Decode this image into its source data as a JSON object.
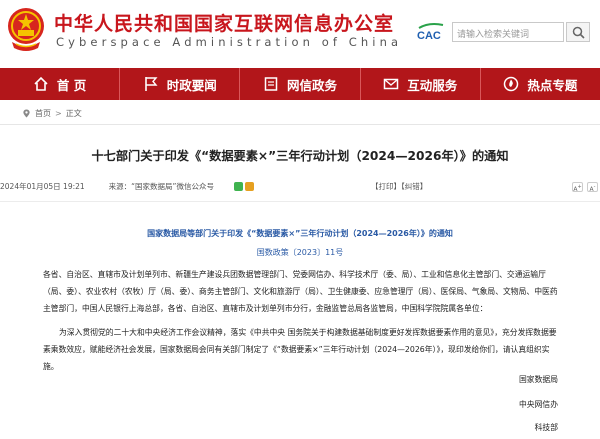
{
  "header": {
    "site_title": "中华人民共和国国家互联网信息办公室",
    "site_subtitle": "Cyberspace  Administration  of  China",
    "logo_text": "CAC",
    "search_placeholder": "请输入检索关键词"
  },
  "nav": {
    "items": [
      {
        "label": "首  页",
        "icon": "home-icon"
      },
      {
        "label": "时政要闻",
        "icon": "flag-icon"
      },
      {
        "label": "网信政务",
        "icon": "document-icon"
      },
      {
        "label": "互动服务",
        "icon": "mail-icon"
      },
      {
        "label": "热点专题",
        "icon": "hot-icon"
      }
    ]
  },
  "breadcrumb": {
    "home": "首页",
    "sep": ">",
    "current": "正文"
  },
  "article": {
    "title": "十七部门关于印发《“数据要素×”三年行动计划（2024—2026年）》的通知",
    "date": "2024年01月05日 19:21",
    "source": "来源：“国家数据局”微信公众号",
    "print": "【打印】",
    "correct": "【纠错】",
    "subtitle": "国家数据局等部门关于印发《“数据要素×”三年行动计划（2024—2026年）》的通知",
    "doc_number": "国数政策〔2023〕11号",
    "paragraph1": "各省、自治区、直辖市及计划单列市、新疆生产建设兵团数据管理部门、党委网信办、科学技术厅（委、局）、工业和信息化主管部门、交通运输厅（局、委）、农业农村（农牧）厅（局、委）、商务主管部门、文化和旅游厅（局）、卫生健康委、应急管理厅（局）、医保局、气象局、文物局、中医药主管部门，中国人民银行上海总部，各省、自治区、直辖市及计划单列市分行，金融监管总局各监管局，中国科学院院属各单位：",
    "paragraph2": "为深入贯彻党的二十大和中央经济工作会议精神，落实《中共中央 国务院关于构建数据基础制度更好发挥数据要素作用的意见》，充分发挥数据要素乘数效应，赋能经济社会发展，国家数据局会同有关部门制定了《“数据要素×”三年行动计划（2024—2026年）》，现印发给你们，请认真组织实施。",
    "signatures": [
      "国家数据局",
      "中央网信办",
      "科技部"
    ]
  },
  "colors": {
    "brand_red": "#c8161d",
    "nav_red": "#b2161a",
    "link_blue": "#2a5aa5"
  }
}
